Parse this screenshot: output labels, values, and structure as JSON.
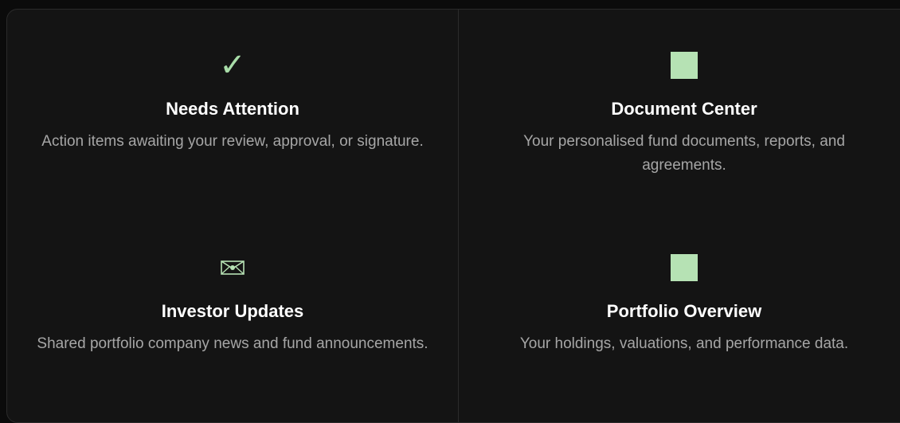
{
  "cards": [
    {
      "icon": "check-icon",
      "title": "Needs Attention",
      "description": "Action items awaiting your review, approval, or signature."
    },
    {
      "icon": "square-icon",
      "title": "Document Center",
      "description": "Your personalised fund documents, reports, and agreements."
    },
    {
      "icon": "envelope-icon",
      "title": "Investor Updates",
      "description": "Shared portfolio company news and fund announcements."
    },
    {
      "icon": "square-icon",
      "title": "Portfolio Overview",
      "description": "Your holdings, valuations, and performance data."
    }
  ],
  "colors": {
    "accent": "#b6e2b4",
    "background": "#141414",
    "border": "#2b2b2b",
    "title": "#ffffff",
    "description": "#a6a6a6"
  }
}
